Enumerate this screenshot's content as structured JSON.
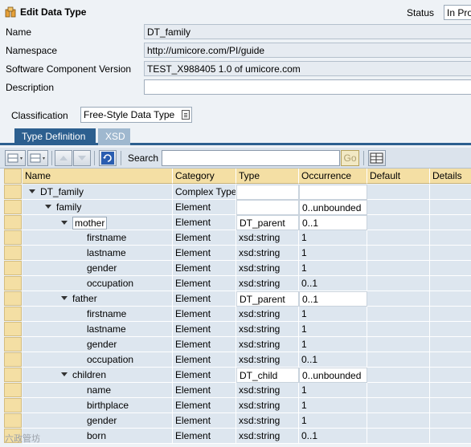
{
  "header": {
    "title": "Edit Data Type",
    "status_label": "Status",
    "status_value": "In Pro"
  },
  "fields": [
    {
      "label": "Name",
      "value": "DT_family"
    },
    {
      "label": "Namespace",
      "value": "http://umicore.com/PI/guide"
    },
    {
      "label": "Software Component Version",
      "value": "TEST_X988405 1.0 of umicore.com"
    },
    {
      "label": "Description",
      "value": ""
    }
  ],
  "classification": {
    "label": "Classification",
    "value": "Free-Style Data Type"
  },
  "tabs": [
    {
      "label": "Type Definition",
      "active": true
    },
    {
      "label": "XSD",
      "active": false
    }
  ],
  "toolbar": {
    "search_label": "Search",
    "search_value": "",
    "go_label": "Go"
  },
  "table": {
    "columns": [
      "Name",
      "Category",
      "Type",
      "Occurrence",
      "Default",
      "Details"
    ],
    "rows": [
      {
        "level": 0,
        "expand": true,
        "name": "DT_family",
        "category": "Complex Type",
        "type": "",
        "occurrence": ""
      },
      {
        "level": 1,
        "expand": true,
        "name": "family",
        "category": "Element",
        "type": "",
        "occurrence": "0..unbounded"
      },
      {
        "level": 2,
        "expand": true,
        "name": "mother",
        "category": "Element",
        "type": "DT_parent",
        "occurrence": "0..1",
        "boxed": true
      },
      {
        "level": 3,
        "expand": false,
        "name": "firstname",
        "category": "Element",
        "type": "xsd:string",
        "occurrence": "1"
      },
      {
        "level": 3,
        "expand": false,
        "name": "lastname",
        "category": "Element",
        "type": "xsd:string",
        "occurrence": "1"
      },
      {
        "level": 3,
        "expand": false,
        "name": "gender",
        "category": "Element",
        "type": "xsd:string",
        "occurrence": "1"
      },
      {
        "level": 3,
        "expand": false,
        "name": "occupation",
        "category": "Element",
        "type": "xsd:string",
        "occurrence": "0..1"
      },
      {
        "level": 2,
        "expand": true,
        "name": "father",
        "category": "Element",
        "type": "DT_parent",
        "occurrence": "0..1"
      },
      {
        "level": 3,
        "expand": false,
        "name": "firstname",
        "category": "Element",
        "type": "xsd:string",
        "occurrence": "1"
      },
      {
        "level": 3,
        "expand": false,
        "name": "lastname",
        "category": "Element",
        "type": "xsd:string",
        "occurrence": "1"
      },
      {
        "level": 3,
        "expand": false,
        "name": "gender",
        "category": "Element",
        "type": "xsd:string",
        "occurrence": "1"
      },
      {
        "level": 3,
        "expand": false,
        "name": "occupation",
        "category": "Element",
        "type": "xsd:string",
        "occurrence": "0..1"
      },
      {
        "level": 2,
        "expand": true,
        "name": "children",
        "category": "Element",
        "type": "DT_child",
        "occurrence": "0..unbounded"
      },
      {
        "level": 3,
        "expand": false,
        "name": "name",
        "category": "Element",
        "type": "xsd:string",
        "occurrence": "1"
      },
      {
        "level": 3,
        "expand": false,
        "name": "birthplace",
        "category": "Element",
        "type": "xsd:string",
        "occurrence": "1"
      },
      {
        "level": 3,
        "expand": false,
        "name": "gender",
        "category": "Element",
        "type": "xsd:string",
        "occurrence": "1"
      },
      {
        "level": 3,
        "expand": false,
        "name": "born",
        "category": "Element",
        "type": "xsd:string",
        "occurrence": "0..1"
      }
    ]
  },
  "watermark": "六政管坊"
}
